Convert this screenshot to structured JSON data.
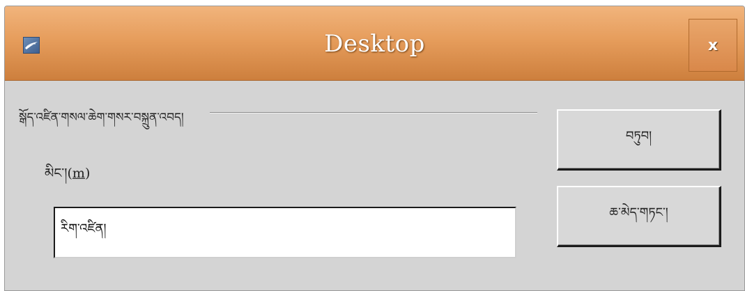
{
  "window": {
    "title": "Desktop",
    "close_label": "x",
    "app_icon": "openoffice-gull-icon"
  },
  "form": {
    "frame_label": "སྒོད་འཛིན་གསལ་ཆེག་གསར་བསྐྲུན་འབད།",
    "name_label_text": "མིང་།(",
    "name_label_accel": "m",
    "name_label_close": ")",
    "name_value": "རིག་འཛིན།"
  },
  "buttons": {
    "ok_label": "བཏུབ།",
    "cancel_label": "ཆ་མེད་གཏང་།"
  },
  "colors": {
    "titlebar": "#e69d5c",
    "body": "#d4d4d4"
  }
}
